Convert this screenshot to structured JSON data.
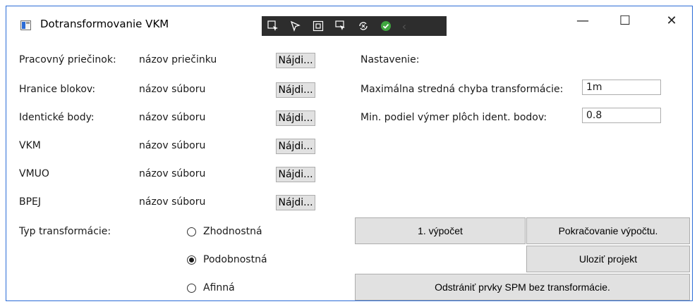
{
  "window": {
    "title": "Dotransformovanie VKM",
    "controls": {
      "minimize": "—",
      "maximize": "☐",
      "close": "✕"
    }
  },
  "debug_toolbar": {
    "icons": [
      "select-element-icon",
      "pointer-icon",
      "layout-adorner-icon",
      "track-focus-icon",
      "hot-reload-icon",
      "check-icon"
    ],
    "collapse": "‹"
  },
  "form": {
    "rows": [
      {
        "label": "Pracovný priečinok:",
        "value": "názov priečinku",
        "button": "Nájdi..."
      },
      {
        "label": "Hranice blokov:",
        "value": "názov súboru",
        "button": "Nájdi..."
      },
      {
        "label": "Identické body:",
        "value": "názov súboru",
        "button": "Nájdi..."
      },
      {
        "label": "VKM",
        "value": "názov súboru",
        "button": "Nájdi..."
      },
      {
        "label": "VMUO",
        "value": "názov súboru",
        "button": "Nájdi..."
      },
      {
        "label": "BPEJ",
        "value": "názov súboru",
        "button": "Nájdi..."
      }
    ],
    "transform_type": {
      "label": "Typ transformácie:",
      "options": [
        {
          "label": "Zhodnostná",
          "checked": false
        },
        {
          "label": "Podobnostná",
          "checked": true
        },
        {
          "label": "Afinná",
          "checked": false
        }
      ]
    }
  },
  "settings": {
    "heading": "Nastavenie:",
    "max_error_label": "Maximálna stredná chyba transformácie:",
    "max_error_value": "1m",
    "min_ratio_label": "Min. podiel výmer plôch ident. bodov:",
    "min_ratio_value": "0.8"
  },
  "actions": {
    "first_calc": "1. výpočet",
    "continue_calc": "Pokračovanie výpočtu.",
    "save_project": "Uloziť projekt",
    "remove_spm": "Odstrániť prvky SPM bez transformácie."
  }
}
